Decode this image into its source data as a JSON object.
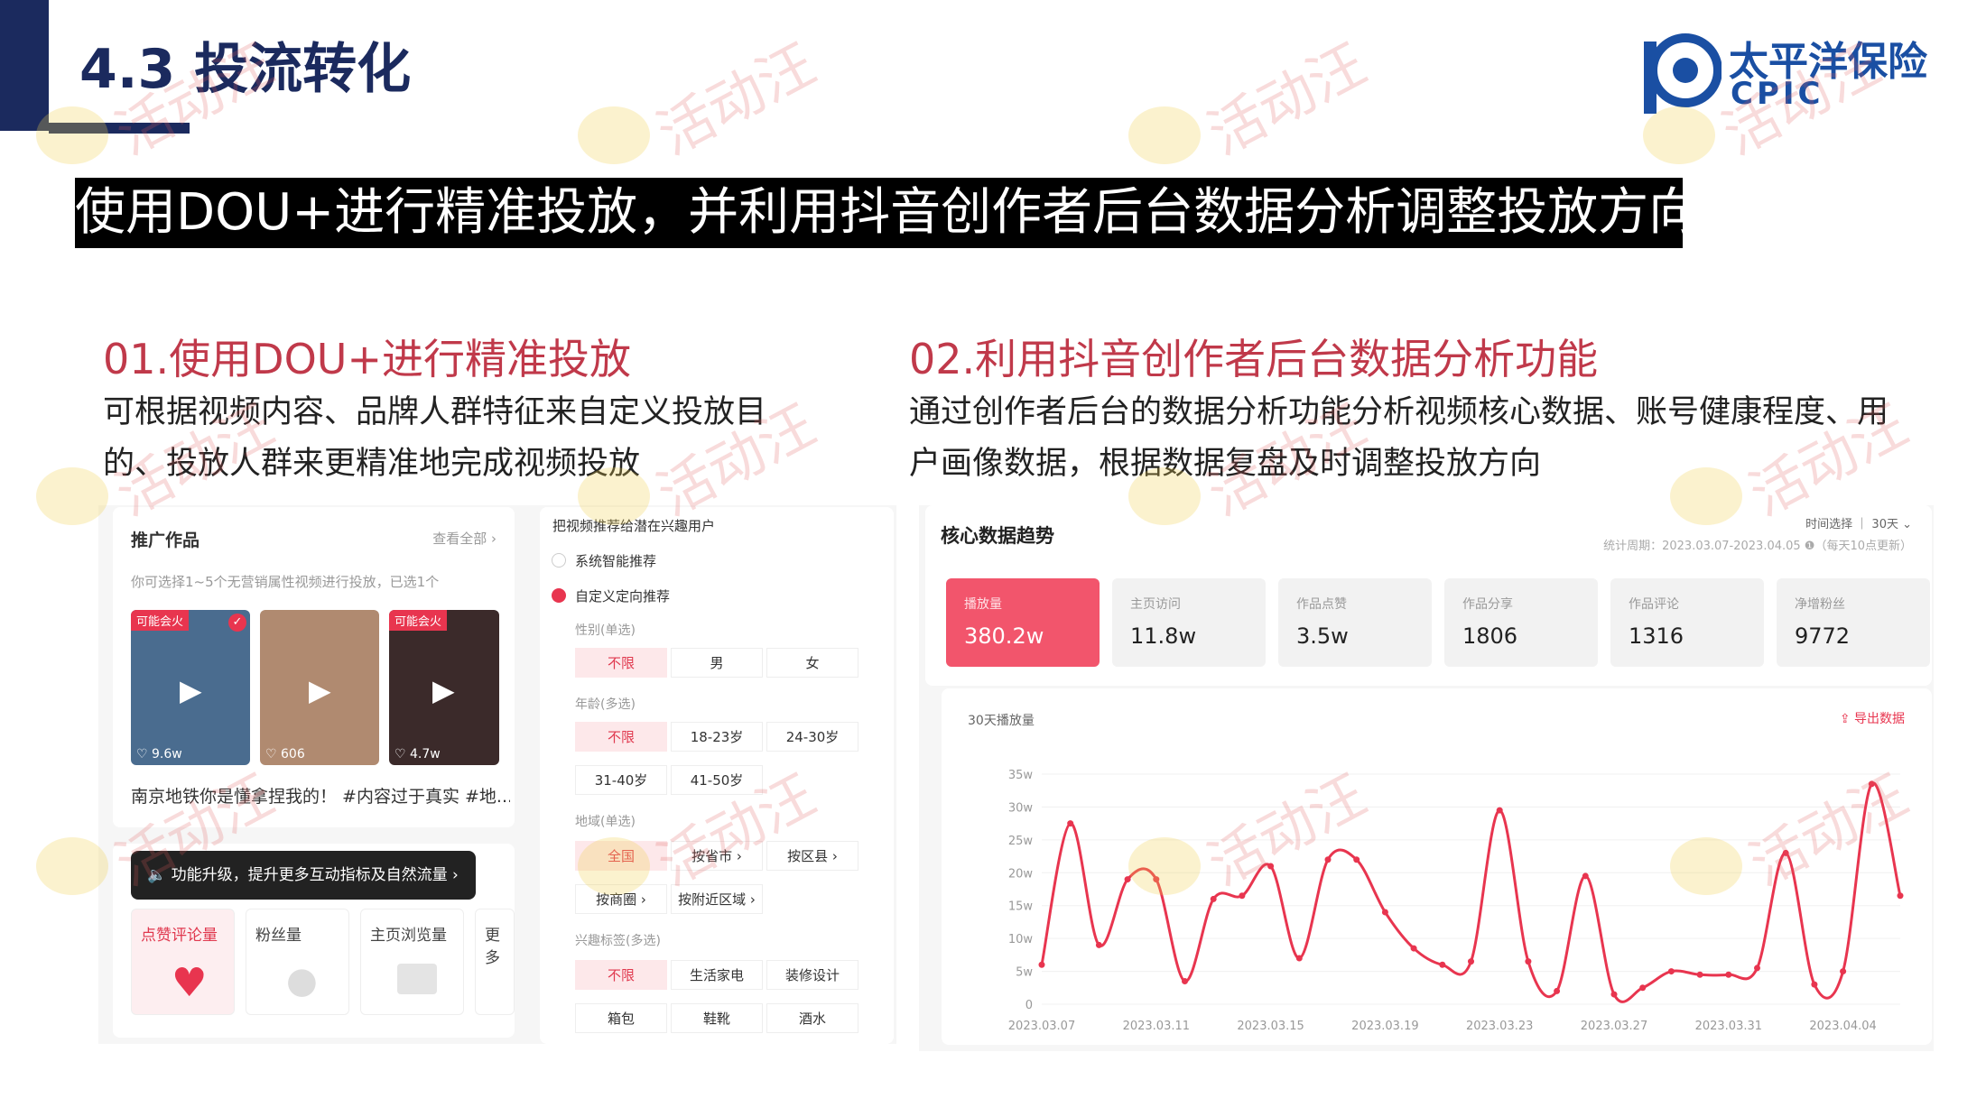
{
  "header": {
    "title": "4.3 投流转化",
    "logo_cn": "太平洋保险",
    "logo_en": "CPIC",
    "banner": "使用DOU+进行精准投放，并利用抖音创作者后台数据分析调整投放方向"
  },
  "section1": {
    "heading": "01.使用DOU+进行精准投放",
    "desc": "可根据视频内容、品牌人群特征来自定义投放目的、投放人群来更精准地完成视频投放"
  },
  "section2": {
    "heading": "02.利用抖音创作者后台数据分析功能",
    "desc": "通过创作者后台的数据分析功能分析视频核心数据、账号健康程度、用户画像数据，根据数据复盘及时调整投放方向"
  },
  "watermark": "活动汪",
  "dou": {
    "promo_title": "推广作品",
    "view_all": "查看全部 ›",
    "promo_hint": "你可选择1~5个无营销属性视频进行投放，已选1个",
    "videos": [
      {
        "badge": "可能会火",
        "likes": "♡ 9.6w",
        "color": "#4a6c8f"
      },
      {
        "badge": "",
        "likes": "♡ 606",
        "color": "#b08a70"
      },
      {
        "badge": "可能会火",
        "likes": "♡ 4.7w",
        "color": "#3b2a2a"
      }
    ],
    "video_caption": "南京地铁你是懂拿捏我的！ #内容过于真实 #地...",
    "tip": "🔈 功能升级，提升更多互动指标及自然流量 ›",
    "metrics": [
      "点赞评论量",
      "粉丝量",
      "主页浏览量",
      "更多"
    ],
    "target_title": "把视频推荐给潜在兴趣用户",
    "opt_smart": "系统智能推荐",
    "opt_custom": "自定义定向推荐",
    "gender_label": "性别(单选)",
    "gender": [
      "不限",
      "男",
      "女"
    ],
    "age_label": "年龄(多选)",
    "age": [
      "不限",
      "18-23岁",
      "24-30岁",
      "31-40岁",
      "41-50岁"
    ],
    "region_label": "地域(单选)",
    "region": [
      "全国",
      "按省市 ›",
      "按区县 ›",
      "按商圈 ›",
      "按附近区域 ›"
    ],
    "interest_label": "兴趣标签(多选)",
    "interest": [
      "不限",
      "生活家电",
      "装修设计",
      "箱包",
      "鞋靴",
      "酒水"
    ]
  },
  "dash": {
    "title": "核心数据趋势",
    "time_select": "时间选择 ｜ 30天 ⌄",
    "period": "统计周期：2023.03.07-2023.04.05 ❶（每天10点更新）",
    "stats": [
      {
        "label": "播放量",
        "value": "380.2w"
      },
      {
        "label": "主页访问",
        "value": "11.8w"
      },
      {
        "label": "作品点赞",
        "value": "3.5w"
      },
      {
        "label": "作品分享",
        "value": "1806"
      },
      {
        "label": "作品评论",
        "value": "1316"
      },
      {
        "label": "净增粉丝",
        "value": "9772"
      }
    ],
    "chart_title": "30天播放量",
    "export": "导出数据"
  },
  "chart_data": {
    "type": "line",
    "title": "30天播放量",
    "ylim": [
      0,
      35
    ],
    "yticks": [
      "0",
      "5w",
      "10w",
      "15w",
      "20w",
      "25w",
      "30w",
      "35w"
    ],
    "xticks": [
      "2023.03.07",
      "2023.03.11",
      "2023.03.15",
      "2023.03.19",
      "2023.03.23",
      "2023.03.27",
      "2023.03.31",
      "2023.04.04"
    ],
    "series": [
      {
        "values": [
          6,
          27.5,
          9,
          19,
          19,
          3.5,
          16,
          16.5,
          21,
          7,
          22,
          22,
          14,
          8.5,
          6,
          6.5,
          29.5,
          6.5,
          2,
          19.5,
          1.5,
          2.5,
          5,
          4.5,
          4.5,
          5.5,
          23,
          3,
          5,
          33.5,
          16.5
        ]
      }
    ],
    "color": "#e8354f",
    "grid": true
  }
}
